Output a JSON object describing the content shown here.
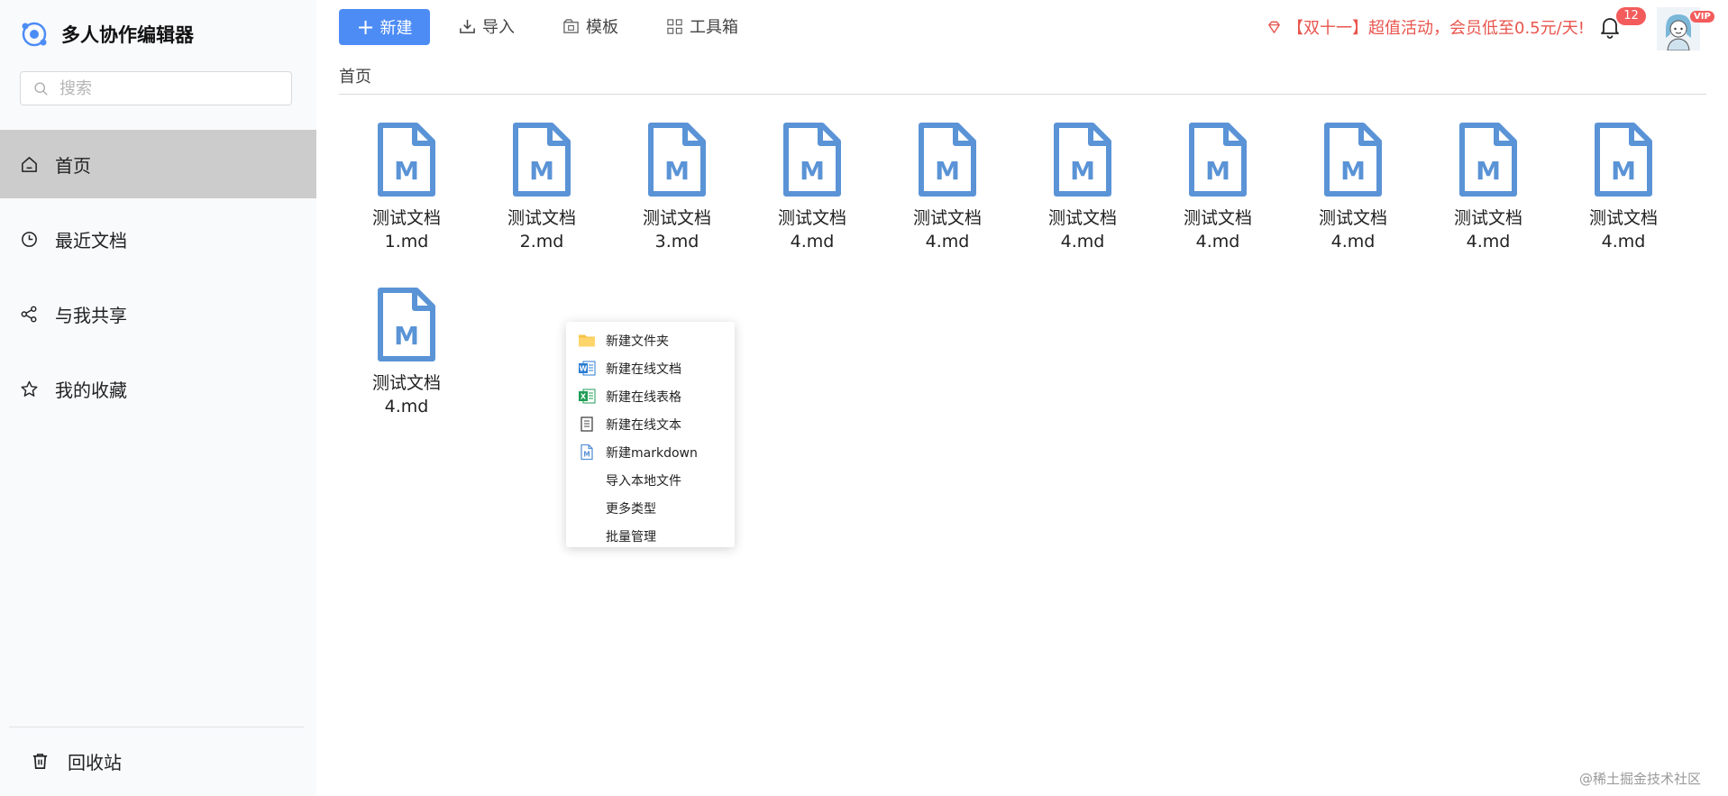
{
  "app": {
    "title": "多人协作编辑器"
  },
  "search": {
    "placeholder": "搜索"
  },
  "sidebar": {
    "items": [
      {
        "label": "首页",
        "icon": "home-icon",
        "active": true
      },
      {
        "label": "最近文档",
        "icon": "clock-icon"
      },
      {
        "label": "与我共享",
        "icon": "share-icon"
      },
      {
        "label": "我的收藏",
        "icon": "star-icon"
      }
    ],
    "trash_label": "回收站"
  },
  "toolbar": {
    "new_label": "新建",
    "import_label": "导入",
    "template_label": "模板",
    "toolbox_label": "工具箱"
  },
  "header": {
    "promo": "【双十一】超值活动，会员低至0.5元/天!",
    "notification_count": "12",
    "vip_label": "VIP"
  },
  "breadcrumb": "首页",
  "files": [
    {
      "line1": "测试文档",
      "line2": "1.md"
    },
    {
      "line1": "测试文档",
      "line2": "2.md"
    },
    {
      "line1": "测试文档",
      "line2": "3.md"
    },
    {
      "line1": "测试文档",
      "line2": "4.md"
    },
    {
      "line1": "测试文档",
      "line2": "4.md"
    },
    {
      "line1": "测试文档",
      "line2": "4.md"
    },
    {
      "line1": "测试文档",
      "line2": "4.md"
    },
    {
      "line1": "测试文档",
      "line2": "4.md"
    },
    {
      "line1": "测试文档",
      "line2": "4.md"
    },
    {
      "line1": "测试文档",
      "line2": "4.md"
    },
    {
      "line1": "测试文档",
      "line2": "4.md"
    }
  ],
  "context_menu": [
    {
      "label": "新建文件夹",
      "icon": "folder-icon"
    },
    {
      "label": "新建在线文档",
      "icon": "word-icon"
    },
    {
      "label": "新建在线表格",
      "icon": "excel-icon"
    },
    {
      "label": "新建在线文本",
      "icon": "text-file-icon"
    },
    {
      "label": "新建markdown",
      "icon": "markdown-icon"
    },
    {
      "label": "导入本地文件",
      "icon": ""
    },
    {
      "label": "更多类型",
      "icon": ""
    },
    {
      "label": "批量管理",
      "icon": ""
    }
  ],
  "watermark": "@稀土掘金技术社区",
  "colors": {
    "accent": "#4d8cf5",
    "file_icon": "#5a93d6",
    "promo": "#e8554e",
    "badge": "#f45b5b",
    "active_nav": "#cccccc"
  }
}
